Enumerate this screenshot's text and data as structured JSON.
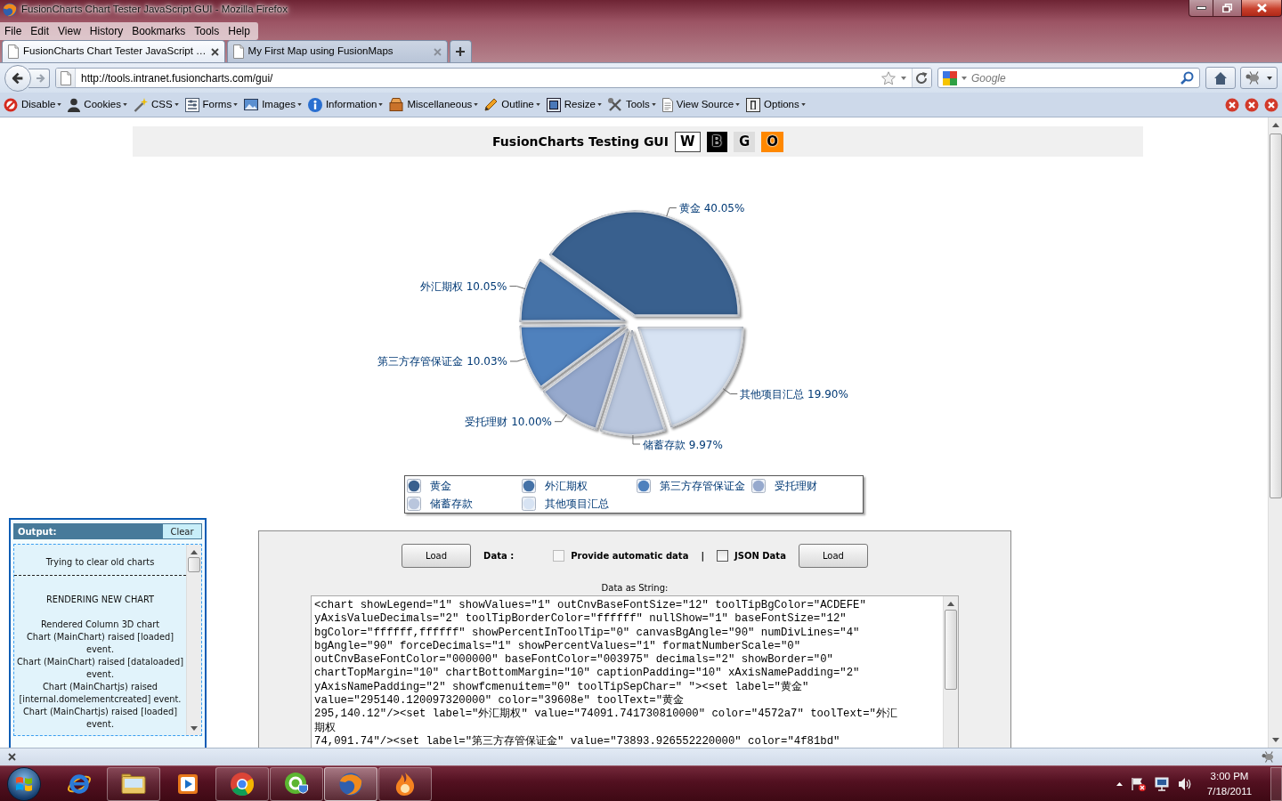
{
  "window": {
    "title": "FusionCharts Chart Tester JavaScript GUI - Mozilla Firefox"
  },
  "menu_bar": {
    "items": [
      "File",
      "Edit",
      "View",
      "History",
      "Bookmarks",
      "Tools",
      "Help"
    ]
  },
  "tabs": [
    {
      "label": "FusionCharts Chart Tester JavaScript …",
      "selected": true
    },
    {
      "label": "My First Map using FusionMaps",
      "selected": false
    }
  ],
  "address_bar": {
    "url": "http://tools.intranet.fusioncharts.com/gui/"
  },
  "search_bar": {
    "placeholder": "Google"
  },
  "developer_toolbar": {
    "items": [
      {
        "label": "Disable"
      },
      {
        "label": "Cookies"
      },
      {
        "label": "CSS"
      },
      {
        "label": "Forms"
      },
      {
        "label": "Images"
      },
      {
        "label": "Information"
      },
      {
        "label": "Miscellaneous"
      },
      {
        "label": "Outline"
      },
      {
        "label": "Resize"
      },
      {
        "label": "Tools"
      },
      {
        "label": "View Source"
      },
      {
        "label": "Options"
      }
    ]
  },
  "page": {
    "header": {
      "title": "FusionCharts Testing GUI",
      "themes": [
        {
          "label": "W",
          "color": "#ffffff"
        },
        {
          "label": "B",
          "color": "#000000"
        },
        {
          "label": "G",
          "color": "#dddddd"
        },
        {
          "label": "O",
          "color": "#ff8800"
        }
      ]
    },
    "chart": {
      "chart_data": {
        "type": "pie",
        "categories": [
          "黄金",
          "外汇期权",
          "第三方存管保证金",
          "受托理财",
          "储蓄存款",
          "其他项目汇总"
        ],
        "values": [
          40.05,
          10.05,
          10.03,
          10.0,
          9.97,
          19.9
        ],
        "value_labels": [
          "40.05%",
          "10.05%",
          "10.03%",
          "10.00%",
          "9.97%",
          "19.90%"
        ]
      },
      "legend": [
        {
          "label": "黄金",
          "color": "#39608e"
        },
        {
          "label": "外汇期权",
          "color": "#4572a7"
        },
        {
          "label": "第三方存管保证金",
          "color": "#4f81bd"
        },
        {
          "label": "受托理财",
          "color": "#96a9cd"
        },
        {
          "label": "储蓄存款",
          "color": "#b9c6dd"
        },
        {
          "label": "其他项目汇总",
          "color": "#d7e3f3"
        }
      ]
    },
    "output_panel": {
      "title": "Output:",
      "clear_button": "Clear",
      "log": [
        {
          "kind": "message",
          "text": "Trying to clear old charts"
        },
        {
          "kind": "separator"
        },
        {
          "kind": "heading",
          "text": "RENDERING NEW CHART"
        },
        {
          "kind": "message",
          "text": "Rendered Column 3D chart"
        },
        {
          "kind": "message",
          "text": "Chart (MainChart) raised [loaded] event."
        },
        {
          "kind": "message",
          "text": "Chart (MainChart) raised [dataloaded] event."
        },
        {
          "kind": "message",
          "text": "Chart (MainChartjs) raised [internal.domelementcreated] event."
        },
        {
          "kind": "message",
          "text": "Chart (MainChartjs) raised [loaded] event."
        }
      ]
    },
    "data_panel": {
      "controls": [
        {
          "kind": "button",
          "label": "Load"
        },
        {
          "kind": "label",
          "label": "Data :"
        },
        {
          "kind": "checkbox",
          "label": "Provide automatic data",
          "checked": false,
          "disabled": true
        },
        {
          "kind": "divider",
          "label": "|"
        },
        {
          "kind": "checkbox",
          "label": "JSON Data",
          "checked": false,
          "disabled": false
        },
        {
          "kind": "button",
          "label": "Load"
        }
      ],
      "string_label": "Data as String:",
      "data_string": {
        "lines": [
          "<chart showLegend=\"1\" showValues=\"1\" outCnvBaseFontSize=\"12\" toolTipBgColor=\"ACDEFE\"",
          "yAxisValueDecimals=\"2\" toolTipBorderColor=\"ffffff\" nullShow=\"1\" baseFontSize=\"12\"",
          "bgColor=\"ffffff,ffffff\" showPercentInToolTip=\"0\" canvasBgAngle=\"90\" numDivLines=\"4\"",
          "bgAngle=\"90\" forceDecimals=\"1\" showPercentValues=\"1\" formatNumberScale=\"0\"",
          "outCnvBaseFontColor=\"000000\" baseFontColor=\"003975\" decimals=\"2\" showBorder=\"0\"",
          "chartTopMargin=\"10\" chartBottomMargin=\"10\" captionPadding=\"10\" xAxisNamePadding=\"2\"",
          "yAxisNamePadding=\"2\" showfcmenuitem=\"0\" toolTipSepChar=\" \"><set label=\"黄金\"",
          "value=\"295140.120097320000\" color=\"39608e\" toolText=\"黄金",
          "295,140.12\"/><set label=\"外汇期权\" value=\"74091.741730810000\" color=\"4572a7\" toolText=\"外汇",
          "期权",
          "74,091.74\"/><set label=\"第三方存管保证金\" value=\"73893.926552220000\" color=\"4f81bd\""
        ]
      }
    }
  },
  "taskbar": {
    "apps": [
      {
        "running": false,
        "selected": false
      },
      {
        "running": true,
        "selected": false
      },
      {
        "running": false,
        "selected": false
      },
      {
        "running": true,
        "selected": false
      },
      {
        "running": true,
        "selected": false
      },
      {
        "running": true,
        "selected": true
      },
      {
        "running": true,
        "selected": false
      }
    ],
    "clock": {
      "time": "3:00 PM",
      "date": "7/18/2011"
    }
  }
}
